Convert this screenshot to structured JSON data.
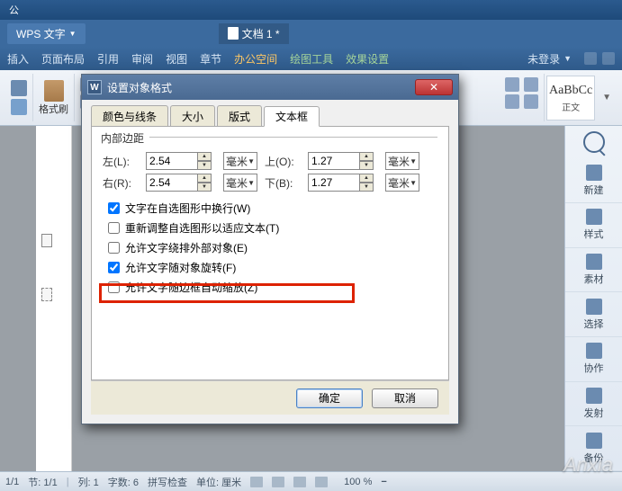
{
  "window": {
    "title": "公"
  },
  "app_button": {
    "label": "WPS 文字"
  },
  "doc_tab": {
    "label": "文档 1 *"
  },
  "ribbon": {
    "tabs": [
      "插入",
      "页面布局",
      "引用",
      "审阅",
      "视图",
      "章节",
      "办公空间",
      "绘图工具",
      "效果设置"
    ],
    "login": "未登录"
  },
  "toolbar": {
    "format_brush": "格式刷",
    "style_preview": "AaBbCc",
    "style_name": "正文"
  },
  "dialog": {
    "title": "设置对象格式",
    "tabs": {
      "t1": "颜色与线条",
      "t2": "大小",
      "t3": "版式",
      "t4": "文本框"
    },
    "section": "内部边距",
    "labels": {
      "left": "左(L):",
      "right": "右(R):",
      "top": "上(O):",
      "bottom": "下(B):"
    },
    "values": {
      "left": "2.54",
      "right": "2.54",
      "top": "1.27",
      "bottom": "1.27"
    },
    "unit": "毫米",
    "checks": {
      "c1": "文字在自选图形中换行(W)",
      "c2": "重新调整自选图形以适应文本(T)",
      "c3": "允许文字绕排外部对象(E)",
      "c4": "允许文字随对象旋转(F)",
      "c5": "允许文字随边框自动缩放(Z)"
    },
    "buttons": {
      "ok": "确定",
      "cancel": "取消"
    }
  },
  "sidebar": {
    "new": "新建",
    "style": "样式",
    "material": "素材",
    "select": "选择",
    "collab": "协作",
    "send": "发射",
    "backup": "备份"
  },
  "status": {
    "page": "1/1",
    "section": "节: 1/1",
    "col": "列: 1",
    "chars": "字数: 6",
    "spell": "拼写检查",
    "unit": "单位: 厘米",
    "zoom": "100 %"
  },
  "watermark": "Anxia"
}
